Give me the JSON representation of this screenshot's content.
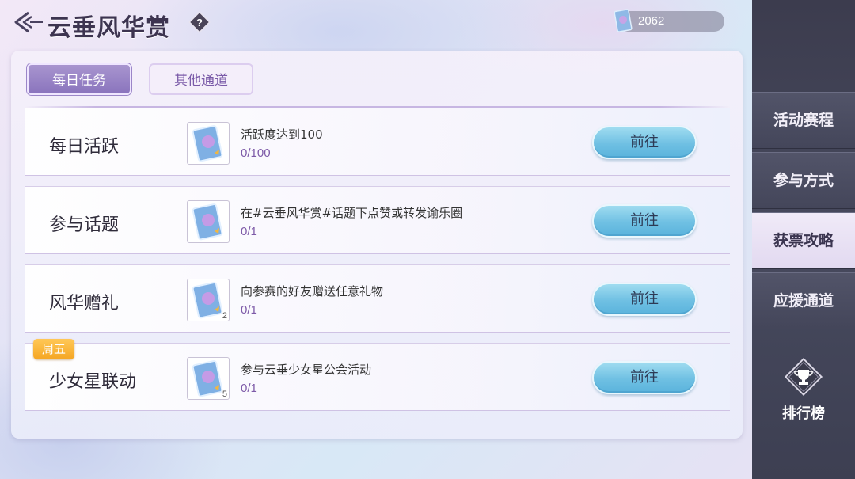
{
  "header": {
    "title": "云垂风华赏",
    "help_symbol": "?",
    "currency_value": "2062"
  },
  "tabs": [
    {
      "label": "每日任务",
      "active": true
    },
    {
      "label": "其他通道",
      "active": false
    }
  ],
  "tasks": [
    {
      "title": "每日活跃",
      "tag": "",
      "reward_count": "",
      "desc": "活跃度达到100",
      "progress": "0/100",
      "button": "前往"
    },
    {
      "title": "参与话题",
      "tag": "",
      "reward_count": "",
      "desc": "在#云垂风华赏#话题下点赞或转发谕乐圈",
      "progress": "0/1",
      "button": "前往"
    },
    {
      "title": "风华赠礼",
      "tag": "",
      "reward_count": "2",
      "desc": "向参赛的好友赠送任意礼物",
      "progress": "0/1",
      "button": "前往"
    },
    {
      "title": "少女星联动",
      "tag": "周五",
      "reward_count": "5",
      "desc": "参与云垂少女星公会活动",
      "progress": "0/1",
      "button": "前往"
    }
  ],
  "sidebar": {
    "items": [
      {
        "label": "活动赛程",
        "active": false
      },
      {
        "label": "参与方式",
        "active": false
      },
      {
        "label": "获票攻略",
        "active": true
      },
      {
        "label": "应援通道",
        "active": false
      }
    ],
    "rank_label": "排行榜"
  },
  "colors": {
    "accent_purple": "#8a74bd",
    "button_blue": "#6fc0e3",
    "tag_orange": "#f5a623",
    "sidebar_dark": "#44465a"
  }
}
